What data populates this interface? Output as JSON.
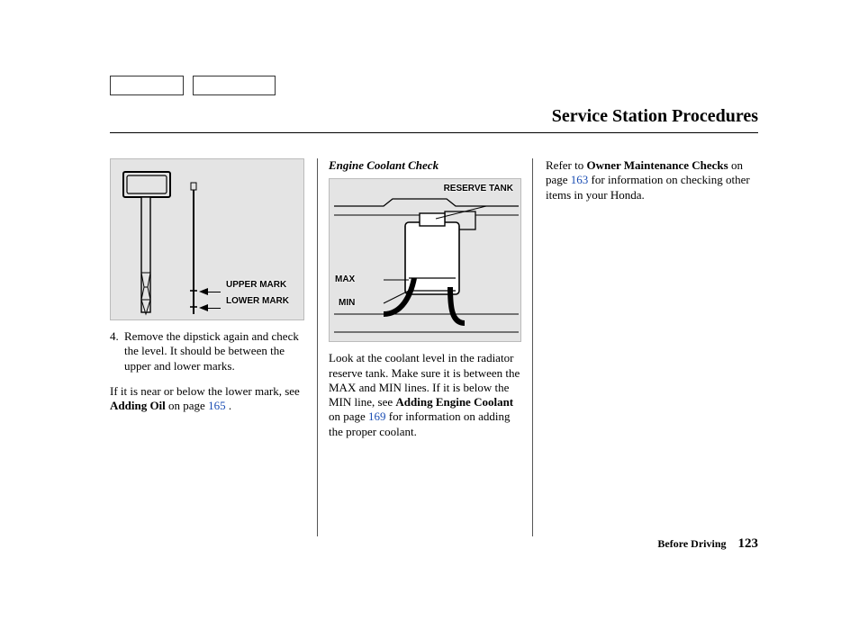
{
  "title": "Service Station Procedures",
  "col1": {
    "fig": {
      "upper": "UPPER MARK",
      "lower": "LOWER MARK"
    },
    "step_num": "4.",
    "step_text": "Remove the dipstick again and check the level. It should be between the upper and lower marks.",
    "para2_a": "If it is near or below the lower mark, see ",
    "para2_b": "Adding Oil",
    "para2_c": " on page ",
    "para2_link": "165",
    "para2_d": " ."
  },
  "col2": {
    "heading": "Engine Coolant Check",
    "fig": {
      "reserve": "RESERVE TANK",
      "max": "MAX",
      "min": "MIN"
    },
    "para_a": "Look at the coolant level in the radiator reserve tank. Make sure it is between the MAX and MIN lines. If it is below the MIN line, see ",
    "para_b": "Adding Engine Coolant",
    "para_c": " on page ",
    "para_link": "169",
    "para_d": " for information on adding the proper coolant."
  },
  "col3": {
    "para_a": "Refer to ",
    "para_b": "Owner Maintenance Checks",
    "para_c": " on page ",
    "para_link": "163",
    "para_d": " for information on checking other items in your Honda."
  },
  "footer": {
    "section": "Before Driving",
    "page": "123"
  }
}
